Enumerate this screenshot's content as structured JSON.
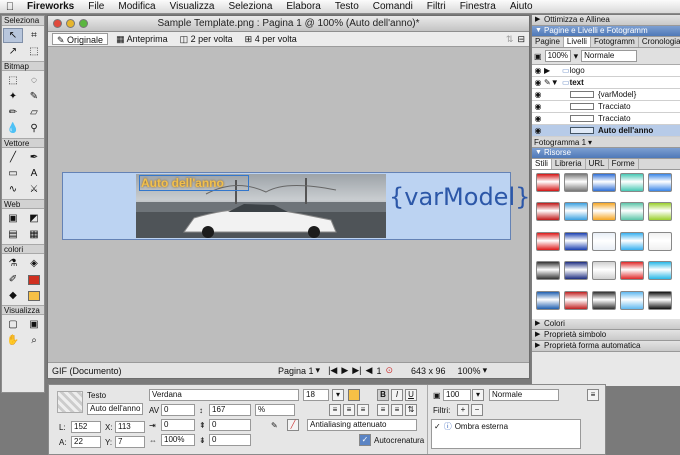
{
  "menubar": {
    "app": "Fireworks",
    "items": [
      "File",
      "Modifica",
      "Visualizza",
      "Seleziona",
      "Elabora",
      "Testo",
      "Comandi",
      "Filtri",
      "Finestra",
      "Aiuto"
    ]
  },
  "tools": {
    "sections": [
      "Seleziona",
      "Bitmap",
      "Vettore",
      "Web",
      "colori",
      "Visualizza"
    ],
    "colors": {
      "stroke": "#d03020",
      "fill": "#f6c046"
    }
  },
  "document": {
    "title": "Sample Template.png : Pagina 1 @ 100% (Auto dell'anno)*",
    "tabs": [
      "Originale",
      "Anteprima",
      "2 per volta",
      "4 per volta"
    ],
    "canvas": {
      "overlay_text": "Auto dell'anno",
      "var_text": "{varModel}"
    },
    "status": {
      "format": "GIF (Documento)",
      "page": "Pagina 1",
      "size": "643 x 96",
      "zoom": "100%"
    }
  },
  "panels": {
    "optimize": "Ottimizza e Allinea",
    "pages_layers_header": "Pagine e Livelli e Fotogramm",
    "pages_layers_tabs": [
      "Pagine",
      "Livelli",
      "Fotogramm",
      "Cronologia"
    ],
    "opacity": "100%",
    "blend": "Normale",
    "layers": [
      "logo",
      "text",
      "{varModel}",
      "Tracciato",
      "Tracciato",
      "Auto dell'anno"
    ],
    "frame": "Fotogramma 1",
    "resources_header": "Risorse",
    "resources_tabs": [
      "Stili",
      "Libreria",
      "URL",
      "Forme"
    ],
    "bottom": [
      "Colori",
      "Proprietà simbolo",
      "Proprietà forma automatica"
    ]
  },
  "properties": {
    "type": "Testo",
    "name": "Auto dell'anno",
    "L": "152",
    "X": "113",
    "A": "22",
    "Y": "7",
    "font": "Verdana",
    "size": "18",
    "kerning": "0",
    "leading": "167",
    "leading_unit": "%",
    "indent": "0",
    "scale": "100%",
    "space_before": "0",
    "space_after": "0",
    "baseline": "0",
    "antialias": "Antialiasing attenuato",
    "autokern": "Autocrenatura",
    "opacity": "100",
    "blend": "Normale",
    "filters_label": "Filtri:",
    "filter_item": "Ombra esterna"
  },
  "swatch_colors": [
    "#d41414",
    "#777777",
    "#2f6fd6",
    "#46c8b4",
    "#3a86e8",
    "#c01818",
    "#3aa0e0",
    "#f5a623",
    "#5bc5a8",
    "#9ad02c",
    "#dd1a1a",
    "#1a3fb0",
    "#e8eef6",
    "#38b0f0",
    "#f0f0f0",
    "#333333",
    "#1d2d80",
    "#d0d0d0",
    "#e02828",
    "#28b8e8",
    "#2060b0",
    "#c02020",
    "#303030",
    "#60b8f0",
    "#101010"
  ]
}
